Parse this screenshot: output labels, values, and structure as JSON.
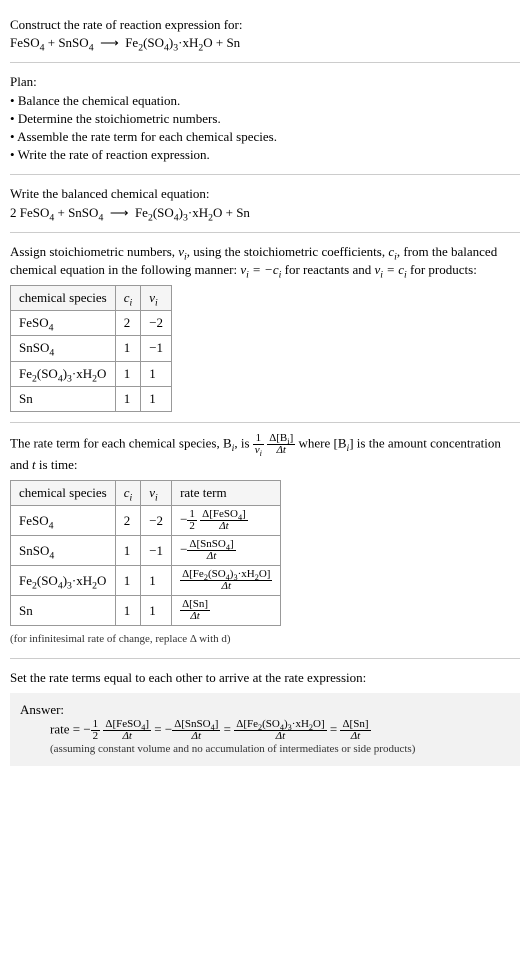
{
  "chart_data": {
    "type": "table",
    "tables": [
      {
        "title": "Stoichiometric numbers",
        "columns": [
          "chemical species",
          "c_i",
          "ν_i"
        ],
        "rows": [
          [
            "FeSO4",
            2,
            -2
          ],
          [
            "SnSO4",
            1,
            -1
          ],
          [
            "Fe2(SO4)3·xH2O",
            1,
            1
          ],
          [
            "Sn",
            1,
            1
          ]
        ]
      },
      {
        "title": "Rate terms",
        "columns": [
          "chemical species",
          "c_i",
          "ν_i",
          "rate term"
        ],
        "rows": [
          [
            "FeSO4",
            2,
            -2,
            "-(1/2) Δ[FeSO4]/Δt"
          ],
          [
            "SnSO4",
            1,
            -1,
            "-Δ[SnSO4]/Δt"
          ],
          [
            "Fe2(SO4)3·xH2O",
            1,
            1,
            "Δ[Fe2(SO4)3·xH2O]/Δt"
          ],
          [
            "Sn",
            1,
            1,
            "Δ[Sn]/Δt"
          ]
        ]
      }
    ]
  },
  "header": {
    "title": "Construct the rate of reaction expression for:",
    "equation": "FeSO₄ + SnSO₄  ⟶  Fe₂(SO₄)₃·xH₂O + Sn"
  },
  "plan": {
    "title": "Plan:",
    "items": [
      "Balance the chemical equation.",
      "Determine the stoichiometric numbers.",
      "Assemble the rate term for each chemical species.",
      "Write the rate of reaction expression."
    ]
  },
  "balanced": {
    "title": "Write the balanced chemical equation:",
    "equation": "2 FeSO₄ + SnSO₄  ⟶  Fe₂(SO₄)₃·xH₂O + Sn"
  },
  "stoich": {
    "intro_a": "Assign stoichiometric numbers, ",
    "intro_b": ", using the stoichiometric coefficients, ",
    "intro_c": ", from the balanced chemical equation in the following manner: ",
    "intro_d": " for reactants and ",
    "intro_e": " for products:",
    "nu": "νᵢ",
    "ci": "cᵢ",
    "rel_react": "νᵢ = −cᵢ",
    "rel_prod": "νᵢ = cᵢ",
    "headers": {
      "species": "chemical species",
      "ci": "cᵢ",
      "nu": "νᵢ"
    },
    "rows": [
      {
        "species": "FeSO₄",
        "ci": "2",
        "nu": "−2"
      },
      {
        "species": "SnSO₄",
        "ci": "1",
        "nu": "−1"
      },
      {
        "species": "Fe₂(SO₄)₃·xH₂O",
        "ci": "1",
        "nu": "1"
      },
      {
        "species": "Sn",
        "ci": "1",
        "nu": "1"
      }
    ]
  },
  "rateterm": {
    "intro_a": "The rate term for each chemical species, B",
    "intro_b": ", is ",
    "intro_c": " where [B",
    "intro_d": "] is the amount concentration and ",
    "intro_e": " is time:",
    "t": "t",
    "headers": {
      "species": "chemical species",
      "ci": "cᵢ",
      "nu": "νᵢ",
      "rate": "rate term"
    },
    "rows": [
      {
        "species": "FeSO₄",
        "ci": "2",
        "nu": "−2"
      },
      {
        "species": "SnSO₄",
        "ci": "1",
        "nu": "−1"
      },
      {
        "species": "Fe₂(SO₄)₃·xH₂O",
        "ci": "1",
        "nu": "1"
      },
      {
        "species": "Sn",
        "ci": "1",
        "nu": "1"
      }
    ],
    "note": "(for infinitesimal rate of change, replace Δ with d)"
  },
  "final": {
    "title": "Set the rate terms equal to each other to arrive at the rate expression:",
    "answer_label": "Answer:",
    "rate_label": "rate = ",
    "note": "(assuming constant volume and no accumulation of intermediates or side products)"
  },
  "frac_labels": {
    "one": "1",
    "two": "2",
    "nu_i": "νᵢ",
    "dBi": "Δ[Bᵢ]",
    "dt": "Δt",
    "dFeSO4": "Δ[FeSO₄]",
    "dSnSO4": "Δ[SnSO₄]",
    "dFe2": "Δ[Fe₂(SO₄)₃·xH₂O]",
    "dSn": "Δ[Sn]",
    "i": "i"
  }
}
